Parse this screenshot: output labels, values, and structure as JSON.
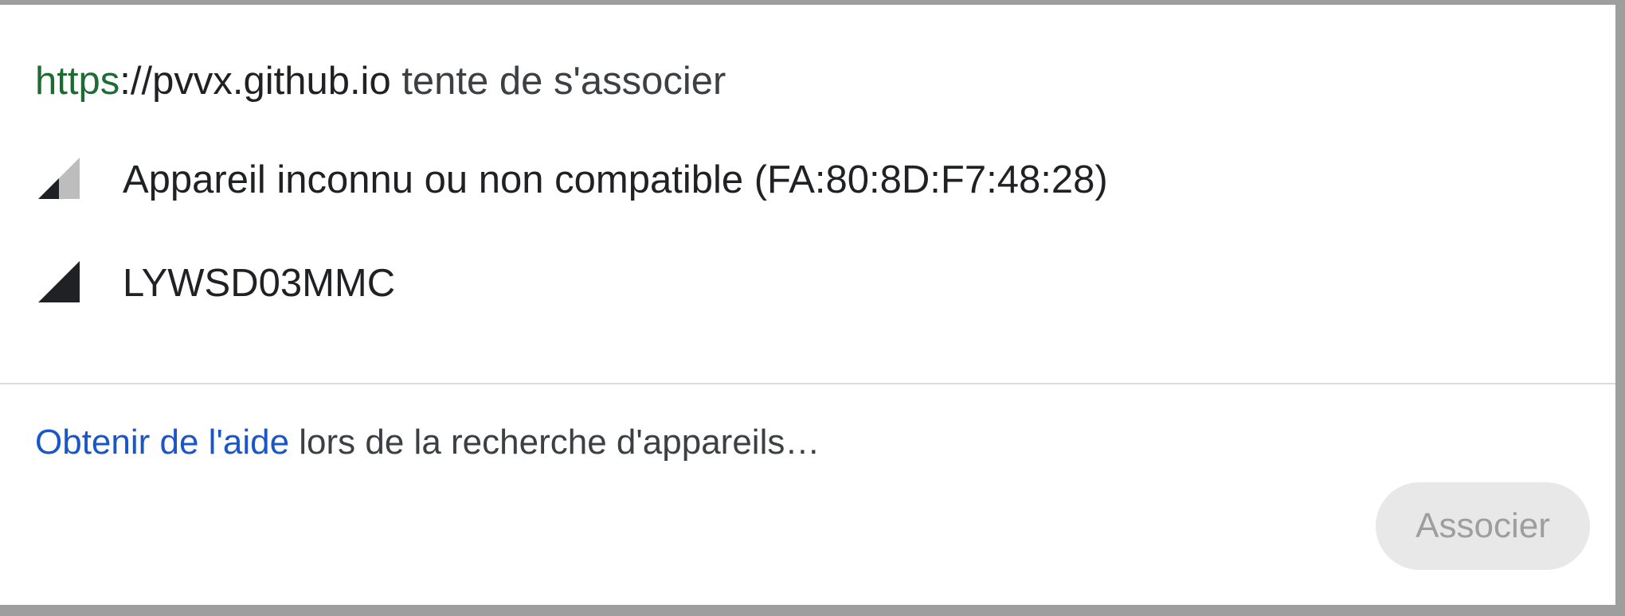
{
  "header": {
    "scheme": "https",
    "host": "://pvvx.github.io",
    "suffix": " tente de s'associer"
  },
  "devices": [
    {
      "name": "Appareil inconnu ou non compatible (FA:80:8D:F7:48:28)",
      "signal_icon": "signal-weak-icon",
      "signal_level": 0.5
    },
    {
      "name": "LYWSD03MMC",
      "signal_icon": "signal-strong-icon",
      "signal_level": 1.0
    }
  ],
  "footer": {
    "help_link": "Obtenir de l'aide",
    "help_text": " lors de la recherche d'appareils…",
    "associate_label": "Associer",
    "associate_enabled": false
  },
  "colors": {
    "scheme_green": "#1e6b34",
    "link_blue": "#1a56c8",
    "signal_dark": "#202124",
    "signal_light": "#bdbdbd",
    "button_disabled_bg": "#e8e8e8",
    "button_disabled_text": "#9e9e9e"
  }
}
